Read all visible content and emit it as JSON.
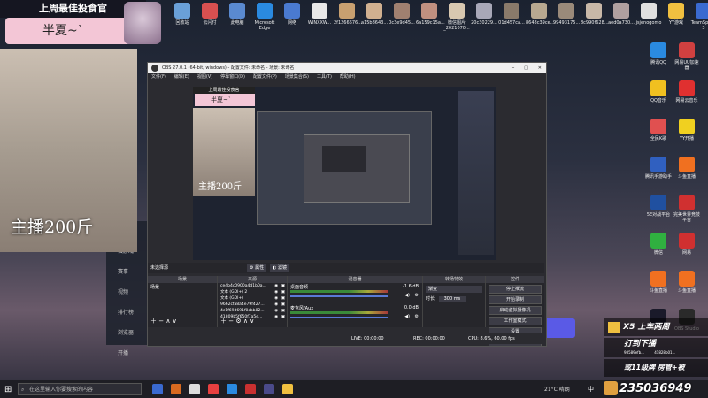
{
  "overlay": {
    "stream_title": "上周最佳投食官",
    "streamer_name": "半夏~`",
    "weight_caption": "主播200斤",
    "promo1_label": "X5  上车两周",
    "promo2_label": "打到下播",
    "promo3_label": "或11级牌  房管+被",
    "promo2_sub_left": "98589efb...",
    "promo2_sub_right": "41828b01...",
    "id_number": "235036949"
  },
  "desktop_icons": [
    "回收站",
    "云闪付",
    "此电脑",
    "Microsoft Edge",
    "网络",
    "WINXXW...",
    "2f1266676...",
    "a15b8643...",
    "0c3e9d45...",
    "6a159c15a...",
    "微信图片_2021070...",
    "20c30229...",
    "01d457ca...",
    "8648c39ce...",
    "99493175...",
    "8c990f628...",
    "aed0a730...",
    "jsjenogomo",
    "YY游戏",
    "TeamSpeak 3"
  ],
  "right_desktop_icons": [
    "腾讯QQ",
    "网易UU加速器",
    "QQ音乐",
    "网易云音乐",
    "全民K歌",
    "YY开播",
    "腾讯手游助手",
    "斗鱼直播",
    "5E对战平台",
    "完美世界竞技平台",
    "微信",
    "网易",
    "斗鱼直播",
    "斗鱼直播",
    "Steam",
    "OBS Studio"
  ],
  "obs": {
    "title": "OBS 27.0.1 (64-bit, windows) - 配置文件: 未命名 - 场景: 未命名",
    "menu": [
      "文件(F)",
      "编辑(E)",
      "视图(V)",
      "停靠窗口(D)",
      "配置文件(P)",
      "场景集合(S)",
      "工具(T)",
      "帮助(H)"
    ],
    "no_source": "未选择源",
    "properties": "属性",
    "filters": "滤镜",
    "docks": {
      "scenes": "场景",
      "sources": "来源",
      "mixer": "混音器",
      "transitions": "转场特效",
      "controls": "控件"
    },
    "scene_list": [
      "场景"
    ],
    "source_list": [
      "ce4b4c0900a4d1b0a...",
      "文本 (GDI+) 2",
      "文本 (GDI+)",
      "9662cfa8a4e79f427...",
      "4c1f69d691f0cbb82...",
      "41809b5f650f7a5e..."
    ],
    "mixer_tracks": [
      {
        "name": "桌面音频",
        "level": "-1.6 dB"
      },
      {
        "name": "麦克风/Aux",
        "level": "0.0 dB"
      }
    ],
    "transition": {
      "type": "渐变",
      "duration_label": "时长",
      "duration": "300 ms"
    },
    "controls": [
      "停止推流",
      "开始录制",
      "启动虚拟摄像机",
      "工作室模式",
      "设置",
      "退出"
    ],
    "status": {
      "live": "LIVE: 00:00:00",
      "rec": "REC: 00:00:00",
      "cpu": "CPU: 8.6%, 60.00 fps"
    }
  },
  "chat_side": [
    "首页",
    "云游戏",
    "赛事",
    "视频",
    "排行榜",
    "浏览器",
    "开播"
  ],
  "taskbar": {
    "search_placeholder": "在这里输入你要搜索的内容",
    "weather": "21°C 晴朗",
    "ime": "中"
  },
  "colors": {
    "obs_bg": "#2b2b30",
    "banner_pink": "#f3c6d6",
    "taskbar": "#1e1e24",
    "accent_blue": "#2d6ad6"
  }
}
